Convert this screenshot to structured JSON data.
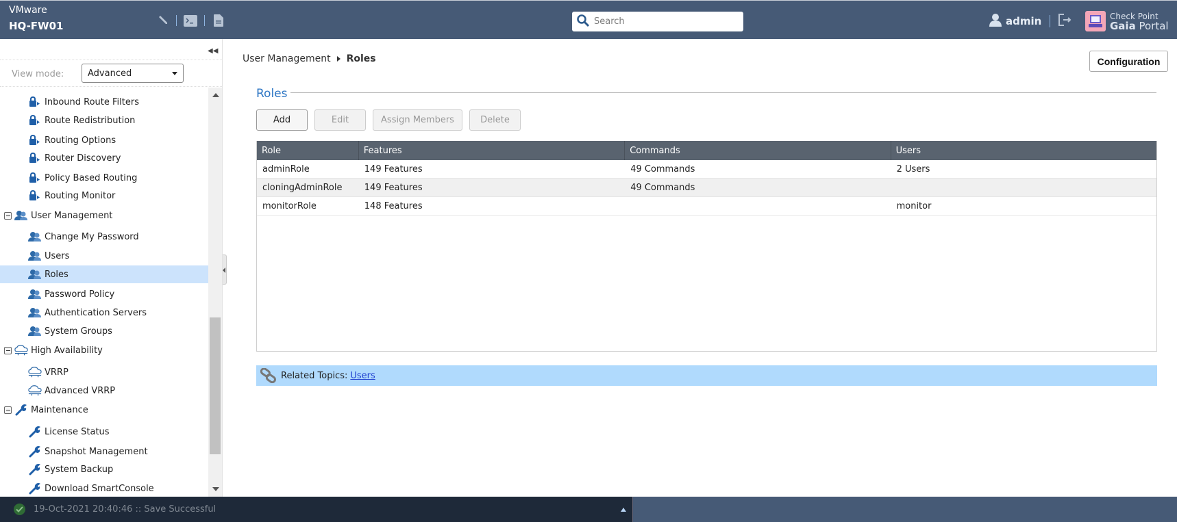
{
  "header": {
    "brand_top": "VMware",
    "hostname": "HQ-FW01",
    "tools": [
      {
        "name": "edit-icon"
      },
      {
        "name": "terminal-icon"
      },
      {
        "name": "document-icon"
      }
    ],
    "search_placeholder": "Search",
    "user": "admin",
    "logo_line1": "Check Point",
    "logo_line2_bold": "Gaia",
    "logo_line2_rest": " Portal"
  },
  "sidebar": {
    "view_mode_label": "View mode:",
    "view_mode_value": "Advanced",
    "items": [
      {
        "label": "Inbound Route Filters",
        "icon": "routing-icon",
        "level": "child"
      },
      {
        "label": "Route Redistribution",
        "icon": "routing-icon",
        "level": "child"
      },
      {
        "label": "Routing Options",
        "icon": "routing-icon",
        "level": "child"
      },
      {
        "label": "Router Discovery",
        "icon": "routing-icon",
        "level": "child"
      },
      {
        "label": "Policy Based Routing",
        "icon": "routing-icon",
        "level": "child"
      },
      {
        "label": "Routing Monitor",
        "icon": "routing-icon",
        "level": "child"
      },
      {
        "label": "User Management",
        "icon": "users-icon",
        "level": "parent"
      },
      {
        "label": "Change My Password",
        "icon": "users-icon",
        "level": "child"
      },
      {
        "label": "Users",
        "icon": "users-icon",
        "level": "child"
      },
      {
        "label": "Roles",
        "icon": "users-icon",
        "level": "child",
        "selected": true
      },
      {
        "label": "Password Policy",
        "icon": "users-icon",
        "level": "child"
      },
      {
        "label": "Authentication Servers",
        "icon": "users-icon",
        "level": "child"
      },
      {
        "label": "System Groups",
        "icon": "users-icon",
        "level": "child"
      },
      {
        "label": "High Availability",
        "icon": "cloud-icon",
        "level": "parent"
      },
      {
        "label": "VRRP",
        "icon": "cloud-icon",
        "level": "child"
      },
      {
        "label": "Advanced VRRP",
        "icon": "cloud-icon",
        "level": "child"
      },
      {
        "label": "Maintenance",
        "icon": "wrench-icon",
        "level": "parent"
      },
      {
        "label": "License Status",
        "icon": "wrench-icon",
        "level": "child"
      },
      {
        "label": "Snapshot Management",
        "icon": "wrench-icon",
        "level": "child"
      },
      {
        "label": "System Backup",
        "icon": "wrench-icon",
        "level": "child"
      },
      {
        "label": "Download SmartConsole",
        "icon": "wrench-icon",
        "level": "child"
      }
    ]
  },
  "main": {
    "breadcrumb": {
      "parent": "User Management",
      "current": "Roles"
    },
    "configuration_label": "Configuration",
    "section_title": "Roles",
    "buttons": {
      "add": "Add",
      "edit": "Edit",
      "assign_members": "Assign Members",
      "delete": "Delete"
    },
    "table": {
      "columns": [
        "Role",
        "Features",
        "Commands",
        "Users"
      ],
      "rows": [
        [
          "adminRole",
          "149 Features",
          "49 Commands",
          "2 Users"
        ],
        [
          "cloningAdminRole",
          "149 Features",
          "49 Commands",
          ""
        ],
        [
          "monitorRole",
          "148 Features",
          "",
          "monitor"
        ]
      ]
    },
    "related_label": "Related Topics:",
    "related_link": "Users"
  },
  "status": {
    "message": "19-Oct-2021 20:40:46 :: Save Successful"
  },
  "colors": {
    "header_bg": "#465a76",
    "accent": "#2d76c4",
    "selected_bg": "#cce3fc",
    "related_bg": "#b0dafd",
    "grid_header_bg": "#59636f",
    "statusbar_bg": "#1e2939"
  }
}
